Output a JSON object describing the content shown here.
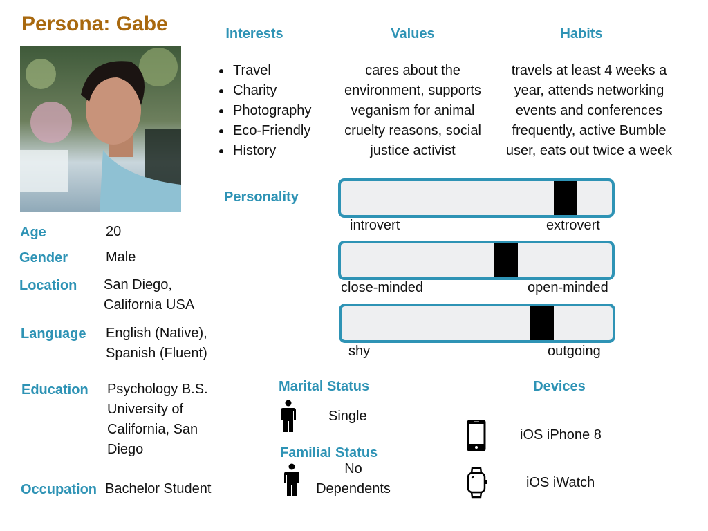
{
  "title": "Persona: Gabe",
  "photo": {
    "alt": "Portrait photo of Gabe"
  },
  "profile": {
    "age": {
      "label": "Age",
      "value": "20"
    },
    "gender": {
      "label": "Gender",
      "value": "Male"
    },
    "location": {
      "label": "Location",
      "lines": [
        "San Diego,",
        "California USA"
      ]
    },
    "language": {
      "label": "Language",
      "lines": [
        "English (Native),",
        "Spanish (Fluent)"
      ]
    },
    "education": {
      "label": "Education",
      "lines": [
        "Psychology B.S.",
        "University of",
        "California, San",
        "Diego"
      ]
    },
    "occupation": {
      "label": "Occupation",
      "value": "Bachelor Student"
    }
  },
  "interests": {
    "heading": "Interests",
    "items": [
      "Travel",
      "Charity",
      "Photography",
      "Eco-Friendly",
      "History"
    ]
  },
  "values": {
    "heading": "Values",
    "lines": [
      "cares about the",
      "environment, supports",
      "veganism for animal",
      "cruelty reasons, social",
      "justice activist"
    ]
  },
  "habits": {
    "heading": "Habits",
    "lines": [
      "travels at least 4 weeks a",
      "year, attends networking",
      "events and conferences",
      "frequently, active Bumble",
      "user, eats out twice a week"
    ]
  },
  "personality": {
    "heading": "Personality",
    "scales": [
      {
        "left": "introvert",
        "right": "extrovert",
        "value": 0.83
      },
      {
        "left": "close-minded",
        "right": "open-minded",
        "value": 0.61
      },
      {
        "left": "shy",
        "right": "outgoing",
        "value": 0.74
      }
    ]
  },
  "marital_status": {
    "heading": "Marital Status",
    "value": "Single",
    "icon": "person-icon"
  },
  "familial_status": {
    "heading": "Familial Status",
    "lines": [
      "No",
      "Dependents"
    ],
    "icon": "person-icon"
  },
  "devices": {
    "heading": "Devices",
    "items": [
      {
        "icon": "smartphone-icon",
        "label": "iOS iPhone 8"
      },
      {
        "icon": "smartwatch-icon",
        "label": "iOS iWatch"
      }
    ]
  },
  "colors": {
    "title": "#a8680e",
    "accent": "#2e93b5",
    "bar_fill": "#eeeff1",
    "marker": "#000000"
  }
}
